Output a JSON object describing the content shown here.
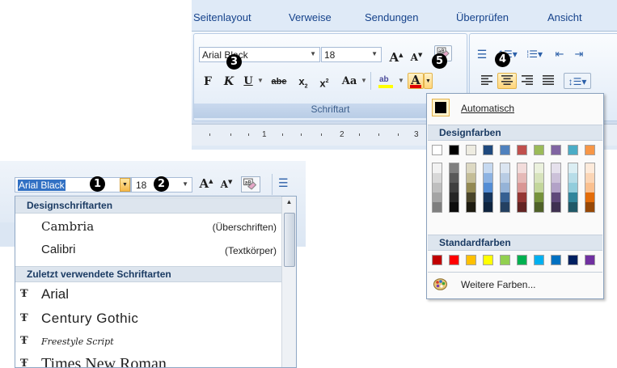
{
  "ribbon": {
    "tabs": [
      "Seitenlayout",
      "Verweise",
      "Sendungen",
      "Überprüfen",
      "Ansicht"
    ],
    "font_name": "Arial Black",
    "font_size": "18",
    "group_label": "Schriftart",
    "grow_font": "A",
    "shrink_font": "A",
    "bold": "F",
    "italic": "K",
    "underline": "U",
    "strikethrough": "abe",
    "subscript": "x",
    "superscript": "x",
    "change_case": "Aa",
    "highlight": "ab",
    "font_color": "A",
    "ruler_numbers": [
      "1",
      "2",
      "3"
    ]
  },
  "markers": [
    "1",
    "2",
    "3",
    "4",
    "5"
  ],
  "color_picker": {
    "automatic_label": "Automatisch",
    "theme_header": "Designfarben",
    "standard_header": "Standardfarben",
    "more_colors_label": "Weitere Farben...",
    "theme_colors": [
      "#ffffff",
      "#000000",
      "#eeece1",
      "#1f497d",
      "#4f81bd",
      "#c0504d",
      "#9bbb59",
      "#8064a2",
      "#4bacc6",
      "#f79646"
    ],
    "theme_shades": [
      [
        "#f2f2f2",
        "#d8d8d8",
        "#bfbfbf",
        "#a5a5a5",
        "#7f7f7f"
      ],
      [
        "#7f7f7f",
        "#595959",
        "#3f3f3f",
        "#262626",
        "#0c0c0c"
      ],
      [
        "#ddd9c3",
        "#c4bd97",
        "#938953",
        "#494429",
        "#1d1b10"
      ],
      [
        "#c6d9f0",
        "#8db3e2",
        "#548dd4",
        "#17365d",
        "#0f243e"
      ],
      [
        "#dbe5f1",
        "#b8cce4",
        "#95b3d7",
        "#366092",
        "#244061"
      ],
      [
        "#f2dcdb",
        "#e5b9b7",
        "#d99694",
        "#953734",
        "#632423"
      ],
      [
        "#ebf1dd",
        "#d7e3bc",
        "#c3d69b",
        "#76923c",
        "#4f6128"
      ],
      [
        "#e5e0ec",
        "#ccc1d9",
        "#b2a2c7",
        "#5f497a",
        "#3f3151"
      ],
      [
        "#dbeef3",
        "#b7dde8",
        "#92cddc",
        "#31859b",
        "#205867"
      ],
      [
        "#fdeada",
        "#fbd5b5",
        "#fac08f",
        "#e36c09",
        "#974806"
      ]
    ],
    "standard_colors": [
      "#c00000",
      "#ff0000",
      "#ffc000",
      "#ffff00",
      "#92d050",
      "#00b050",
      "#00b0f0",
      "#0070c0",
      "#002060",
      "#7030a0"
    ]
  },
  "toolbar2": {
    "font_name": "Arial Black",
    "font_size": "18"
  },
  "font_list": {
    "design_header": "Designschriftarten",
    "recent_header": "Zuletzt verwendete Schriftarten",
    "design_fonts": [
      {
        "name": "Cambria",
        "role": "(Überschriften)"
      },
      {
        "name": "Calibri",
        "role": "(Textkörper)"
      }
    ],
    "recent_fonts": [
      "Arial",
      "Century Gothic",
      "Freestyle Script",
      "Times New Roman"
    ]
  }
}
